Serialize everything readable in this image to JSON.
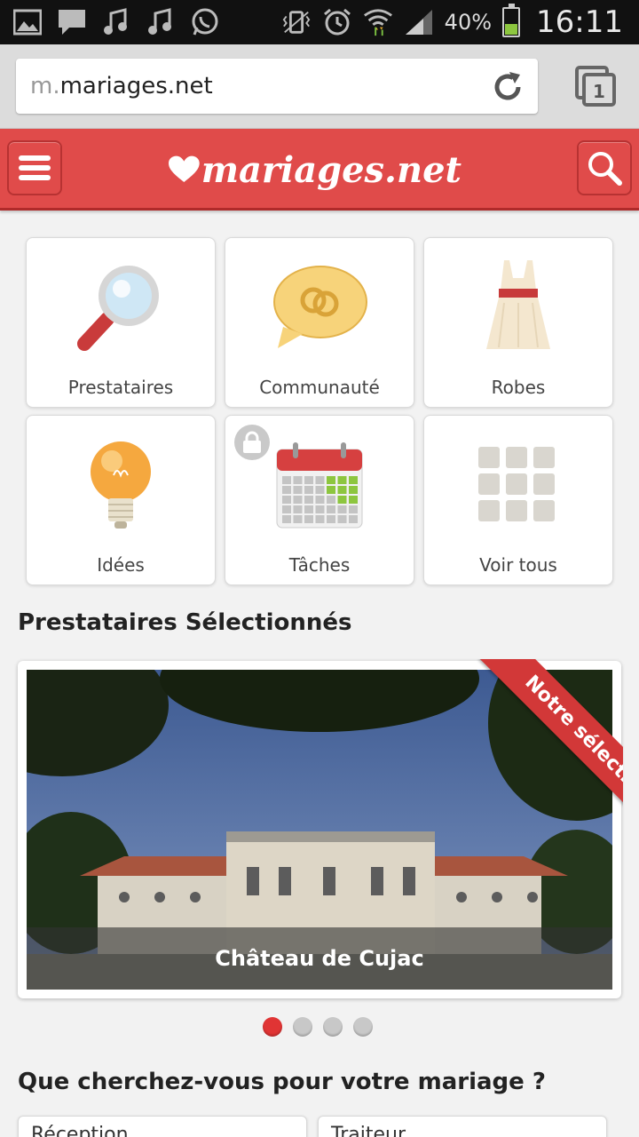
{
  "status_bar": {
    "battery_percent": "40%",
    "time": "16:11",
    "icons": [
      "gallery-icon",
      "message-icon",
      "music-note-icon",
      "music-note-icon",
      "whatsapp-icon",
      "vibrate-icon",
      "alarm-icon",
      "wifi-icon",
      "signal-icon",
      "battery-icon"
    ]
  },
  "browser": {
    "url_prefix": "m.",
    "url_domain": "mariages.net",
    "tabs_count": "1"
  },
  "header": {
    "logo_text": "mariages.net"
  },
  "tiles": [
    {
      "label": "Prestataires",
      "icon": "magnifier-icon"
    },
    {
      "label": "Communauté",
      "icon": "speech-bubble-rings-icon"
    },
    {
      "label": "Robes",
      "icon": "dress-icon"
    },
    {
      "label": "Idées",
      "icon": "lightbulb-icon"
    },
    {
      "label": "Tâches",
      "icon": "calendar-icon",
      "locked": true
    },
    {
      "label": "Voir tous",
      "icon": "grid-icon"
    }
  ],
  "featured": {
    "section_title": "Prestataires Sélectionnés",
    "ribbon": "Notre sélection",
    "caption": "Château de Cujac",
    "slides_total": 4,
    "active_slide": 1
  },
  "search_section": {
    "title": "Que cherchez-vous pour votre mariage ?",
    "categories": [
      "Réception",
      "Traiteur"
    ]
  },
  "colors": {
    "brand_red": "#e04b4a",
    "dot_active": "#e03434"
  }
}
